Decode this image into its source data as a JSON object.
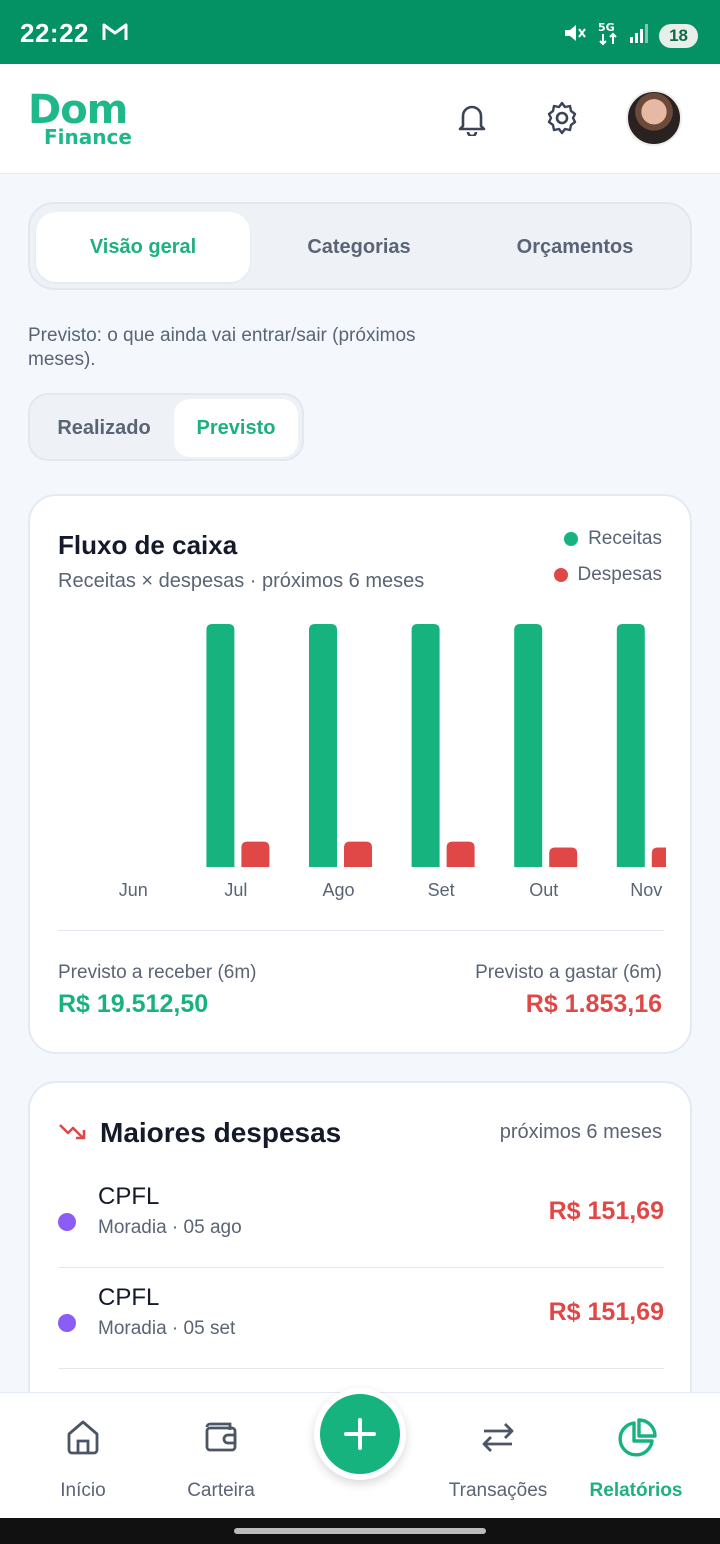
{
  "status_bar": {
    "time": "22:22",
    "battery": "18",
    "icons": [
      "gmail-icon",
      "mute-icon",
      "5g-icon",
      "signal-icon",
      "battery-icon"
    ]
  },
  "header": {
    "logo_line1": "Dom",
    "logo_line2": "Finance",
    "icons": [
      "bell-icon",
      "gear-icon",
      "avatar"
    ]
  },
  "tabs": [
    {
      "label": "Visão geral",
      "active": true
    },
    {
      "label": "Categorias",
      "active": false
    },
    {
      "label": "Orçamentos",
      "active": false
    }
  ],
  "description": "Previsto: o que ainda vai entrar/sair (próximos meses).",
  "segment": [
    {
      "label": "Realizado",
      "active": false
    },
    {
      "label": "Previsto",
      "active": true
    }
  ],
  "cashflow": {
    "title": "Fluxo de caixa",
    "subtitle": "Receitas × despesas · próximos 6 meses",
    "legend": [
      {
        "label": "Receitas",
        "color": "#17b37f"
      },
      {
        "label": "Despesas",
        "color": "#e04848"
      }
    ],
    "summary": {
      "receive_label": "Previsto a receber (6m)",
      "receive_value": "R$ 19.512,50",
      "spend_label": "Previsto a gastar (6m)",
      "spend_value": "R$ 1.853,16"
    }
  },
  "chart_data": {
    "type": "bar",
    "categories": [
      "Jun",
      "Jul",
      "Ago",
      "Set",
      "Out",
      "Nov"
    ],
    "series": [
      {
        "name": "Receitas",
        "color": "#17b37f",
        "values": [
          0,
          3902.5,
          3902.5,
          3902.5,
          3902.5,
          3902.5
        ]
      },
      {
        "name": "Despesas",
        "color": "#e04848",
        "values": [
          0,
          408,
          408,
          408,
          314,
          314
        ]
      }
    ],
    "ylim": [
      0,
      3902.5
    ],
    "grid": false,
    "legend_position": "top-right"
  },
  "top_expenses": {
    "title": "Maiores despesas",
    "subtitle": "próximos 6 meses",
    "items": [
      {
        "name": "CPFL",
        "meta": "Moradia · 05 ago",
        "amount": "R$ 151,69",
        "color": "#8b5cf6"
      },
      {
        "name": "CPFL",
        "meta": "Moradia · 05 set",
        "amount": "R$ 151,69",
        "color": "#8b5cf6"
      }
    ]
  },
  "bottom_nav": [
    {
      "label": "Início",
      "icon": "home-icon",
      "active": false
    },
    {
      "label": "Carteira",
      "icon": "wallet-icon",
      "active": false
    },
    {
      "label": "Transações",
      "icon": "transfer-icon",
      "active": false
    },
    {
      "label": "Relatórios",
      "icon": "pie-chart-icon",
      "active": true
    }
  ],
  "fab_icon": "plus-icon"
}
